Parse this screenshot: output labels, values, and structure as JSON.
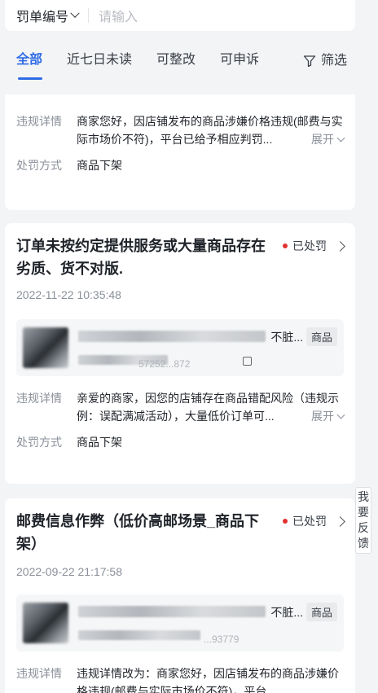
{
  "search": {
    "select_label": "罚单编号",
    "placeholder": "请输入"
  },
  "tabs": [
    {
      "label": "全部",
      "active": true
    },
    {
      "label": "近七日未读"
    },
    {
      "label": "可整改"
    },
    {
      "label": "可申诉"
    }
  ],
  "filter_label": "筛选",
  "expand_label": "展开",
  "labels": {
    "detail": "违规详情",
    "penalty": "处罚方式"
  },
  "cards": [
    {
      "detail": "商家您好，因店铺发布的商品涉嫌价格违规(邮费与实际市场价不符)，平台已给予相应判罚...",
      "penalty": "商品下架"
    },
    {
      "title": "订单未按约定提供服务或大量商品存在劣质、货不对版.",
      "status": "已处罚",
      "date": "2022-11-22 10:35:48",
      "product_name": "不脏...",
      "product_tag": "商品",
      "product_id": "57252...872",
      "detail": "亲爱的商家，因您的店铺存在商品错配风险（违规示例：误配满减活动），大量低价订单可...",
      "penalty": "商品下架"
    },
    {
      "title": "邮费信息作弊（低价高邮场景_商品下架）",
      "status": "已处罚",
      "date": "2022-09-22 21:17:58",
      "product_name": "不脏...",
      "product_tag": "商品",
      "product_id": "...93779",
      "detail": "违规详情改为：商家您好，因店铺发布的商品涉嫌价格违规(邮费与实际市场价不符)，平台..."
    }
  ],
  "feedback_label": "我要反馈",
  "colors": {
    "accent": "#2e6be6",
    "status_dot": "#e03131",
    "background": "#f3f4f6"
  },
  "icons": [
    "chevron-down-icon",
    "filter-icon",
    "chevron-right-icon",
    "copy-icon"
  ]
}
